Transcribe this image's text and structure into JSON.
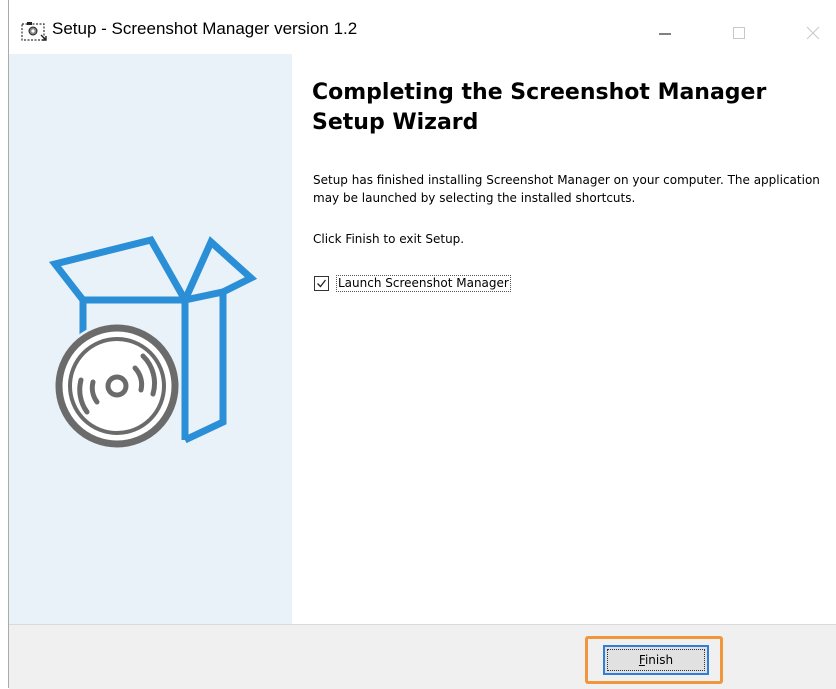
{
  "window": {
    "title": "Setup - Screenshot Manager version 1.2",
    "controls": [
      "minimize-icon",
      "maximize-icon",
      "close-icon"
    ]
  },
  "sidebar": {
    "illustration": "software-box-with-disc"
  },
  "content": {
    "heading": "Completing the Screenshot Manager Setup Wizard",
    "paragraph1": "Setup has finished installing Screenshot Manager on your computer. The application may be launched by selecting the installed shortcuts.",
    "paragraph2": "Click Finish to exit Setup.",
    "launch_checkbox": {
      "label": "Launch Screenshot Manager",
      "checked": true
    }
  },
  "footer": {
    "finish_label": "Finish"
  },
  "colors": {
    "sidebar_bg": "#e9f2f9",
    "accent_blue": "#2a8fd6",
    "disc_gray": "#6b6b6b",
    "highlight_orange": "#f0963c",
    "footer_bg": "#f0f0f0"
  }
}
